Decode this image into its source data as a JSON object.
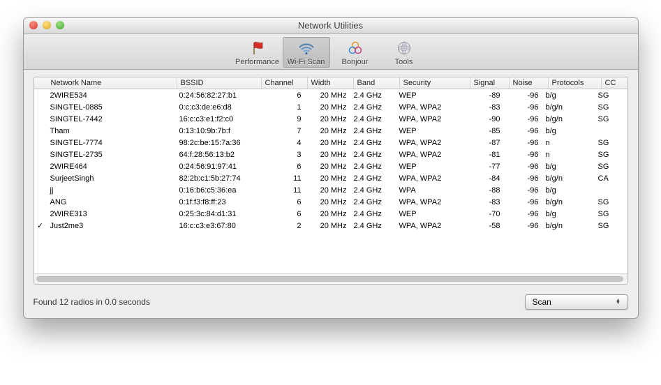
{
  "window": {
    "title": "Network Utilities"
  },
  "toolbar": {
    "performance": "Performance",
    "wifi": "Wi-Fi Scan",
    "bonjour": "Bonjour",
    "tools": "Tools"
  },
  "columns": {
    "name": "Network Name",
    "bssid": "BSSID",
    "channel": "Channel",
    "width": "Width",
    "band": "Band",
    "security": "Security",
    "signal": "Signal",
    "noise": "Noise",
    "protocols": "Protocols",
    "cc": "CC"
  },
  "rows": [
    {
      "check": "",
      "name": "2WIRE534",
      "bssid": "0:24:56:82:27:b1",
      "channel": "6",
      "width": "20 MHz",
      "band": "2.4 GHz",
      "security": "WEP",
      "signal": "-89",
      "noise": "-96",
      "protocols": "b/g",
      "cc": "SG"
    },
    {
      "check": "",
      "name": "SINGTEL-0885",
      "bssid": "0:c:c3:de:e6:d8",
      "channel": "1",
      "width": "20 MHz",
      "band": "2.4 GHz",
      "security": "WPA, WPA2",
      "signal": "-83",
      "noise": "-96",
      "protocols": "b/g/n",
      "cc": "SG"
    },
    {
      "check": "",
      "name": "SINGTEL-7442",
      "bssid": "16:c:c3:e1:f2:c0",
      "channel": "9",
      "width": "20 MHz",
      "band": "2.4 GHz",
      "security": "WPA, WPA2",
      "signal": "-90",
      "noise": "-96",
      "protocols": "b/g/n",
      "cc": "SG"
    },
    {
      "check": "",
      "name": "Tham",
      "bssid": "0:13:10:9b:7b:f",
      "channel": "7",
      "width": "20 MHz",
      "band": "2.4 GHz",
      "security": "WEP",
      "signal": "-85",
      "noise": "-96",
      "protocols": "b/g",
      "cc": ""
    },
    {
      "check": "",
      "name": "SINGTEL-7774",
      "bssid": "98:2c:be:15:7a:36",
      "channel": "4",
      "width": "20 MHz",
      "band": "2.4 GHz",
      "security": "WPA, WPA2",
      "signal": "-87",
      "noise": "-96",
      "protocols": "n",
      "cc": "SG"
    },
    {
      "check": "",
      "name": "SINGTEL-2735",
      "bssid": "64:f:28:56:13:b2",
      "channel": "3",
      "width": "20 MHz",
      "band": "2.4 GHz",
      "security": "WPA, WPA2",
      "signal": "-81",
      "noise": "-96",
      "protocols": "n",
      "cc": "SG"
    },
    {
      "check": "",
      "name": "2WIRE464",
      "bssid": "0:24:56:91:97:41",
      "channel": "6",
      "width": "20 MHz",
      "band": "2.4 GHz",
      "security": "WEP",
      "signal": "-77",
      "noise": "-96",
      "protocols": "b/g",
      "cc": "SG"
    },
    {
      "check": "",
      "name": "SurjeetSingh",
      "bssid": "82:2b:c1:5b:27:74",
      "channel": "11",
      "width": "20 MHz",
      "band": "2.4 GHz",
      "security": "WPA, WPA2",
      "signal": "-84",
      "noise": "-96",
      "protocols": "b/g/n",
      "cc": "CA"
    },
    {
      "check": "",
      "name": "jj",
      "bssid": "0:16:b6:c5:36:ea",
      "channel": "11",
      "width": "20 MHz",
      "band": "2.4 GHz",
      "security": "WPA",
      "signal": "-88",
      "noise": "-96",
      "protocols": "b/g",
      "cc": ""
    },
    {
      "check": "",
      "name": "ANG",
      "bssid": "0:1f:f3:f8:ff:23",
      "channel": "6",
      "width": "20 MHz",
      "band": "2.4 GHz",
      "security": "WPA, WPA2",
      "signal": "-83",
      "noise": "-96",
      "protocols": "b/g/n",
      "cc": "SG"
    },
    {
      "check": "",
      "name": "2WIRE313",
      "bssid": "0:25:3c:84:d1:31",
      "channel": "6",
      "width": "20 MHz",
      "band": "2.4 GHz",
      "security": "WEP",
      "signal": "-70",
      "noise": "-96",
      "protocols": "b/g",
      "cc": "SG"
    },
    {
      "check": "✓",
      "name": "Just2me3",
      "bssid": "16:c:c3:e3:67:80",
      "channel": "2",
      "width": "20 MHz",
      "band": "2.4 GHz",
      "security": "WPA, WPA2",
      "signal": "-58",
      "noise": "-96",
      "protocols": "b/g/n",
      "cc": "SG"
    }
  ],
  "footer": {
    "status": "Found 12 radios in 0.0 seconds",
    "scan_label": "Scan"
  }
}
